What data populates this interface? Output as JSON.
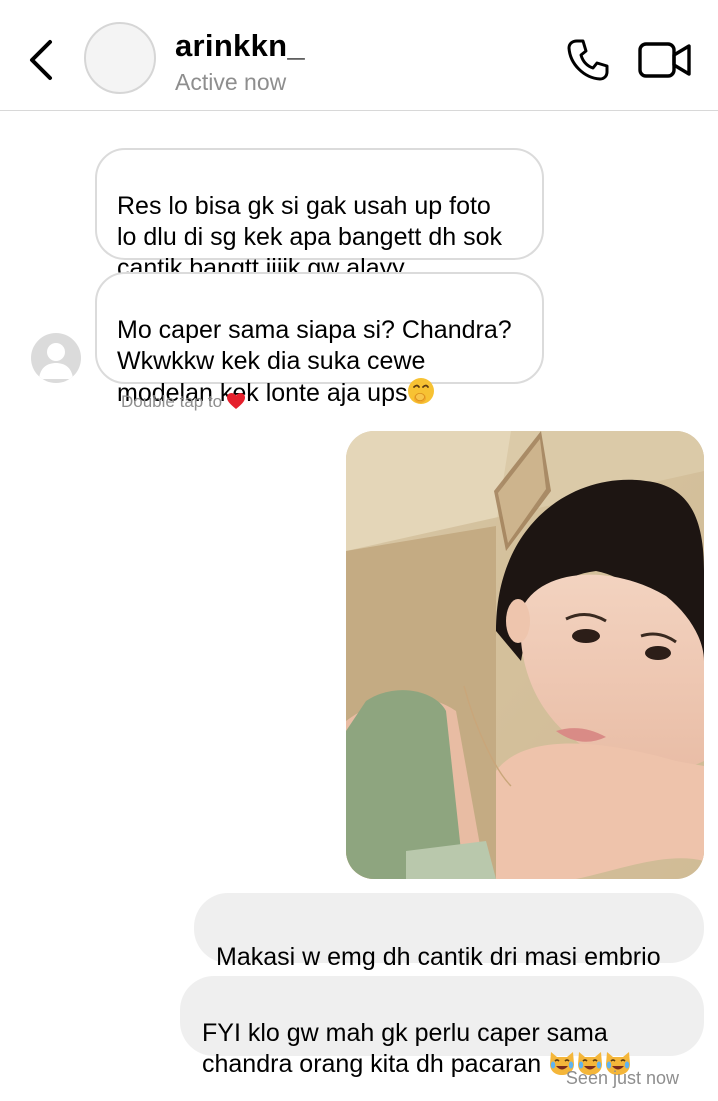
{
  "header": {
    "username": "arinkkn_",
    "status": "Active now"
  },
  "messages": [
    {
      "direction": "incoming",
      "text": "Res lo bisa gk si gak usah up foto\nlo dlu di sg kek apa bangett dh sok\ncantik bangtt jijik gw alayy"
    },
    {
      "direction": "incoming",
      "text": "Mo caper sama siapa si? Chandra?\nWkwkkw kek dia suka cewe\nmodelan kek lonte aja ups",
      "emoji": "face-with-hand-over-mouth-icon"
    },
    {
      "direction": "outgoing",
      "text": "Makasi w emg dh cantik dri masi embrio"
    },
    {
      "direction": "outgoing",
      "text": "FYI klo gw mah gk perlu caper sama\nchandra orang kita dh pacaran ",
      "emoji": "crying-laughing-cat-icon x3"
    }
  ],
  "reaction_hint": {
    "text": "Double tap to",
    "icon": "heart-icon"
  },
  "seen_label": "Seen just now",
  "colors": {
    "outgoing_bubble": "#efefef",
    "incoming_border": "#dbdbdb",
    "muted_text": "#8e8e8e",
    "heart": "#e5202c"
  }
}
